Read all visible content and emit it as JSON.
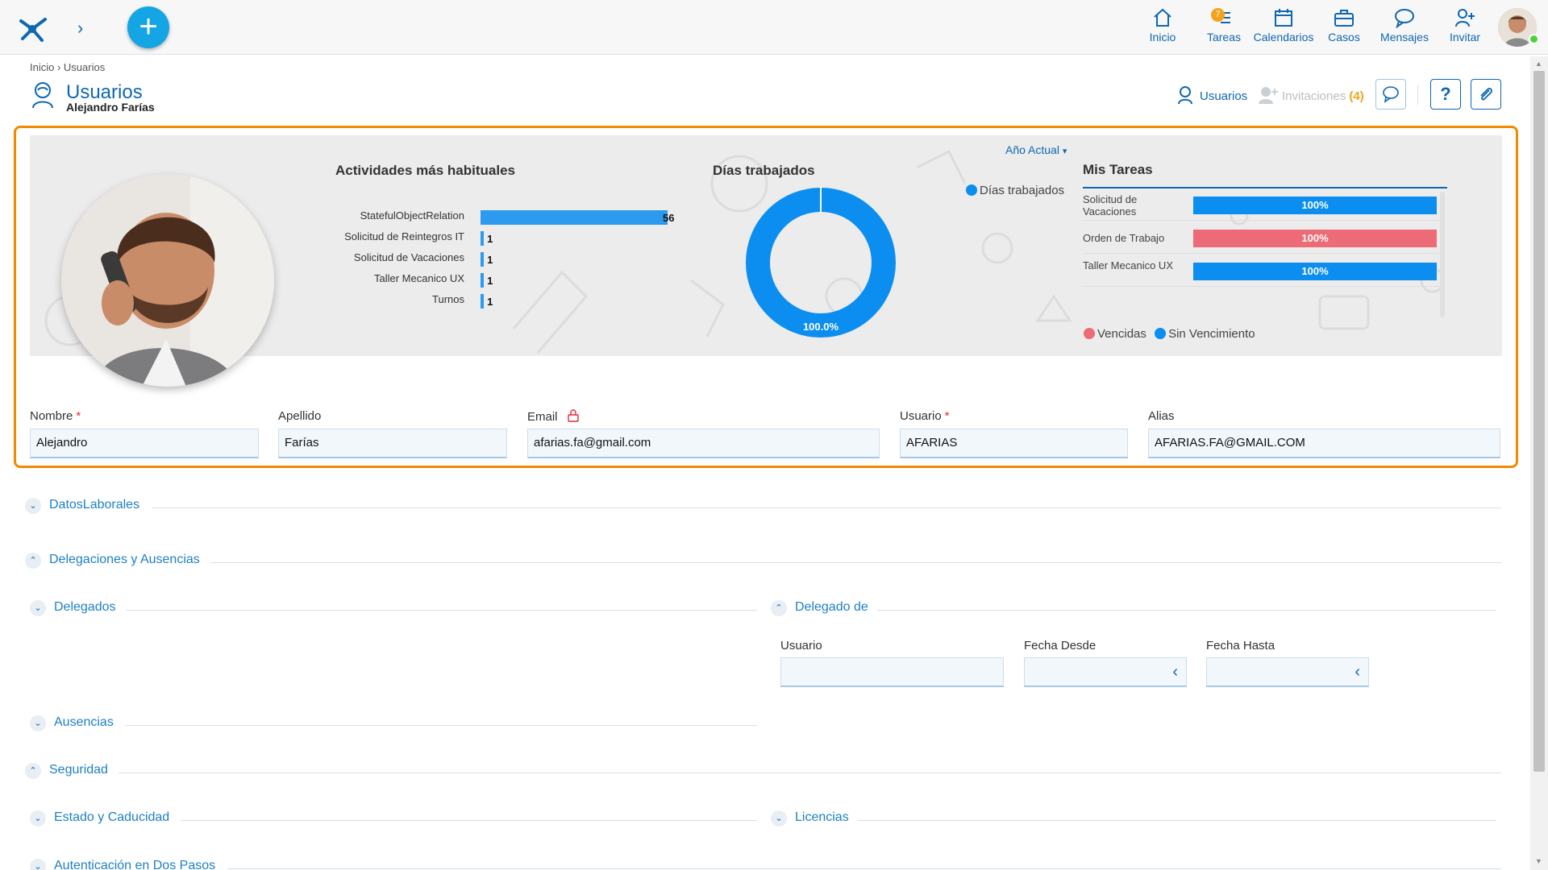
{
  "nav": {
    "items": [
      {
        "label": "Inicio",
        "icon": "home-icon"
      },
      {
        "label": "Tareas",
        "icon": "tasks-icon",
        "badge": "7"
      },
      {
        "label": "Calendarios",
        "icon": "calendar-icon"
      },
      {
        "label": "Casos",
        "icon": "briefcase-icon"
      },
      {
        "label": "Mensajes",
        "icon": "chat-icon"
      },
      {
        "label": "Invitar",
        "icon": "invite-user-icon"
      }
    ]
  },
  "breadcrumb": "Inicio › Usuarios",
  "page": {
    "title": "Usuarios",
    "subtitle": "Alejandro Farías"
  },
  "header_links": {
    "users": "Usuarios",
    "invitations": "Invitaciones",
    "invitations_count": "(4)"
  },
  "dashboard": {
    "period": "Año Actual",
    "activities_title": "Actividades más habituales",
    "days_title": "Días trabajados",
    "days_legend": "Días trabajados",
    "tasks_title": "Mis Tareas",
    "legend_overdue": "Vencidas",
    "legend_no_due": "Sin Vencimiento"
  },
  "chart_data": [
    {
      "type": "bar",
      "title": "Actividades más habituales",
      "categories": [
        "StatefulObjectRelation",
        "Solicitud de Reintegros IT",
        "Solicitud de Vacaciones",
        "Taller Mecanico UX",
        "Turnos"
      ],
      "values": [
        56,
        1,
        1,
        1,
        1
      ],
      "labels": [
        "56",
        "1",
        "1",
        "1",
        "1"
      ]
    },
    {
      "type": "pie",
      "title": "Días trabajados",
      "series": [
        {
          "name": "Días trabajados",
          "values": [
            100
          ]
        }
      ],
      "label": "100.0%",
      "color": "#0b8ef0"
    },
    {
      "type": "bar",
      "title": "Mis Tareas",
      "categories": [
        "Solicitud de Vacaciones",
        "Orden de Trabajo",
        "Taller Mecanico UX"
      ],
      "values": [
        100,
        100,
        100
      ],
      "labels": [
        "100%",
        "100%",
        "100%"
      ],
      "colors": [
        "#0b8ef0",
        "#ec6b76",
        "#0b8ef0"
      ]
    }
  ],
  "form": {
    "nombre": {
      "label": "Nombre",
      "value": "Alejandro"
    },
    "apellido": {
      "label": "Apellido",
      "value": "Farías"
    },
    "email": {
      "label": "Email",
      "value": "afarias.fa@gmail.com"
    },
    "usuario": {
      "label": "Usuario",
      "value": "AFARIAS"
    },
    "alias": {
      "label": "Alias",
      "value": "AFARIAS.FA@GMAIL.COM"
    }
  },
  "groups": {
    "datos": "DatosLaborales",
    "delegaciones": "Delegaciones y Ausencias",
    "delegados": "Delegados",
    "delegado_de": "Delegado de",
    "ausencias": "Ausencias",
    "seguridad": "Seguridad",
    "estado": "Estado y Caducidad",
    "licencias": "Licencias",
    "autenticacion": "Autenticación en Dos Pasos"
  },
  "delegation_fields": {
    "usuario": "Usuario",
    "desde": "Fecha Desde",
    "hasta": "Fecha Hasta"
  },
  "colors": {
    "accent": "#0f67b1",
    "panel_border": "#f08a00",
    "bar_blue": "#0b8ef0",
    "bar_red": "#ec6b76"
  }
}
